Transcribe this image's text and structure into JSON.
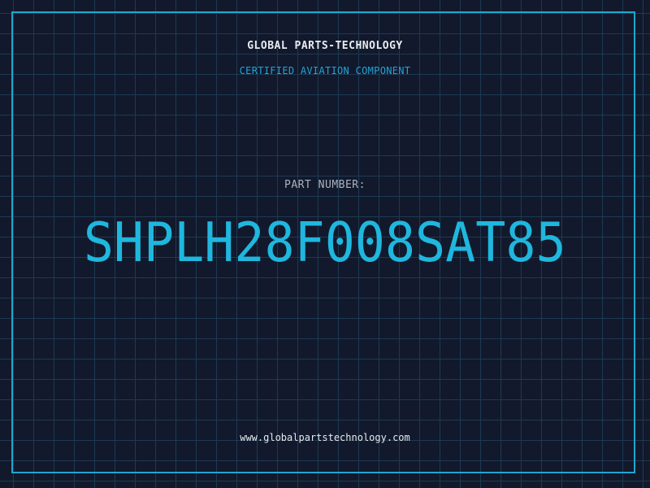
{
  "header": {
    "company": "GLOBAL PARTS-TECHNOLOGY",
    "tagline": "CERTIFIED AVIATION COMPONENT"
  },
  "part": {
    "label": "PART NUMBER:",
    "number": "SHPLH28F008SAT85"
  },
  "footer": {
    "url": "www.globalpartstechnology.com"
  },
  "colors": {
    "background": "#12192c",
    "grid": "#1d3a52",
    "accent": "#1fb7de",
    "frame": "#1fa6cf"
  }
}
